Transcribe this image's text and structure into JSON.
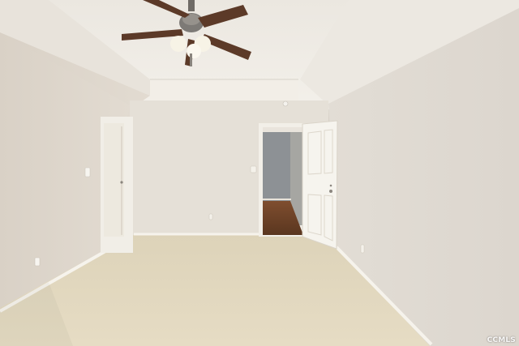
{
  "photo": {
    "watermark_text": "CCMLS"
  },
  "colors": {
    "wall_left": "#dcd5cb",
    "wall_right": "#e4ded6",
    "wall_back": "#e6e1d9",
    "ceiling": "#efebe5",
    "carpet": "#e2d8bf",
    "trim": "#f4f1ea",
    "door": "#f7f5ef",
    "hall_floor": "#6a4228",
    "hall_wall": "#8a8e92",
    "fan_blade": "#5c3a28",
    "fan_metal": "#7d7a76"
  },
  "icons": {
    "fan": "ceiling-fan-icon",
    "outlet": "outlet-icon",
    "switch": "light-switch-icon"
  }
}
